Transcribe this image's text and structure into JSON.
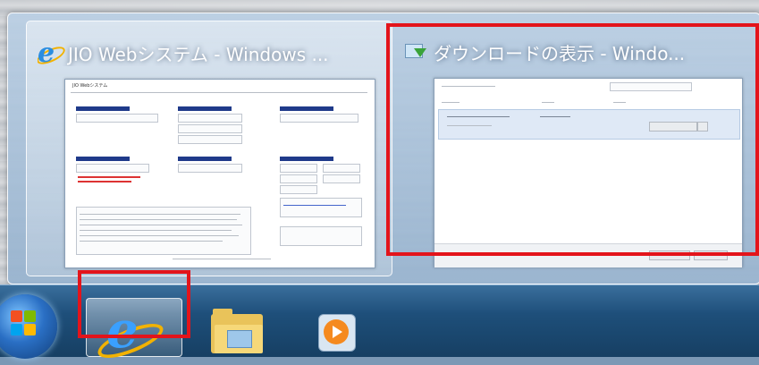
{
  "thumbnails": [
    {
      "title": "JIO Webシステム - Windows ...",
      "icon": "internet-explorer-icon",
      "active": true,
      "preview": {
        "header": "JIO Webシステム",
        "sections": [
          "",
          "",
          "",
          "",
          "",
          ""
        ]
      }
    },
    {
      "title": "ダウンロードの表示 - Windo...",
      "icon": "download-icon",
      "active": false,
      "preview": {
        "header": "",
        "file_row": "",
        "button": ""
      }
    }
  ],
  "taskbar": {
    "items": [
      {
        "name": "start-button",
        "icon": "windows-logo-icon"
      },
      {
        "name": "internet-explorer",
        "icon": "internet-explorer-icon",
        "highlighted": true
      },
      {
        "name": "windows-explorer",
        "icon": "folder-icon"
      },
      {
        "name": "media-player",
        "icon": "media-player-icon"
      }
    ]
  },
  "colors": {
    "highlight": "#e3141b",
    "taskbar": "#1e4f7a",
    "navy_section": "#1f3a8a"
  }
}
